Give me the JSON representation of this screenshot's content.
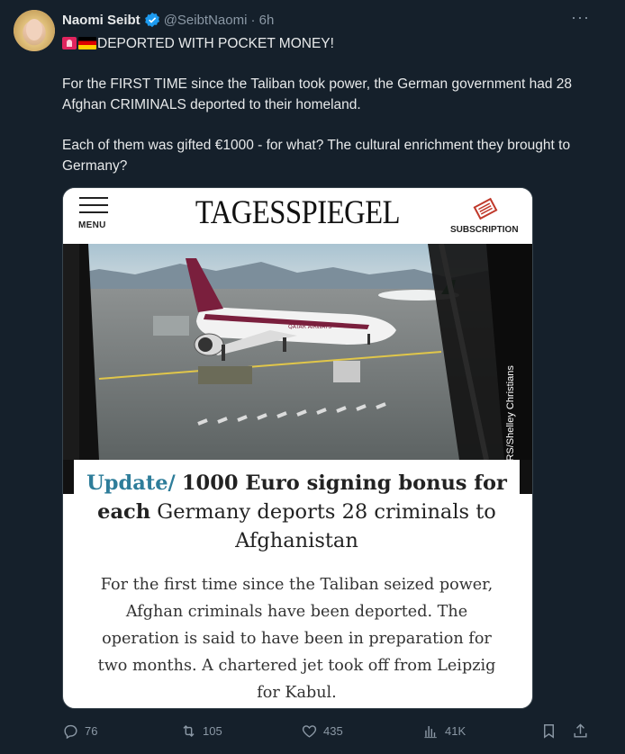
{
  "author": {
    "name": "Naomi Seibt",
    "handle": "@SeibtNaomi",
    "time": "· 6h"
  },
  "tweet": {
    "line1": "DEPORTED WITH POCKET MONEY!",
    "para2": "For the FIRST TIME since the Taliban took power, the German government had 28 Afghan CRIMINALS deported to their homeland.",
    "para3": "Each of them was gifted €1000 - for what? The cultural enrichment they brought to Germany?"
  },
  "card": {
    "menu_label": "MENU",
    "logo": "TAGESSPIEGEL",
    "subscription_label": "SUBSCRIPTION",
    "photo_credit": "© REUTERS/Shelley Christians",
    "plane_livery": "QATAR AIRWAYS",
    "headline_kicker": "Update/",
    "headline_bold": "1000 Euro signing bonus for each",
    "headline_rest": "Germany deports 28 criminals to Afghanistan",
    "lede": "For the first time since the Taliban seized power, Afghan criminals have been deported. The operation is said to have been in preparation for two months. A chartered jet took off from Leipzig for Kabul."
  },
  "actions": {
    "replies": "76",
    "reposts": "105",
    "likes": "435",
    "views": "41K"
  },
  "icons": [
    "verified-badge-icon",
    "more-icon",
    "siren-emoji-icon",
    "german-flag-emoji-icon",
    "menu-icon",
    "newspaper-icon",
    "reply-icon",
    "repost-icon",
    "like-icon",
    "views-icon",
    "bookmark-icon",
    "share-icon"
  ],
  "colors": {
    "background": "#15202b",
    "text": "#e7e9ea",
    "muted": "#8b98a5",
    "verified": "#1d9bf0",
    "update_kicker": "#2e7d9a"
  }
}
